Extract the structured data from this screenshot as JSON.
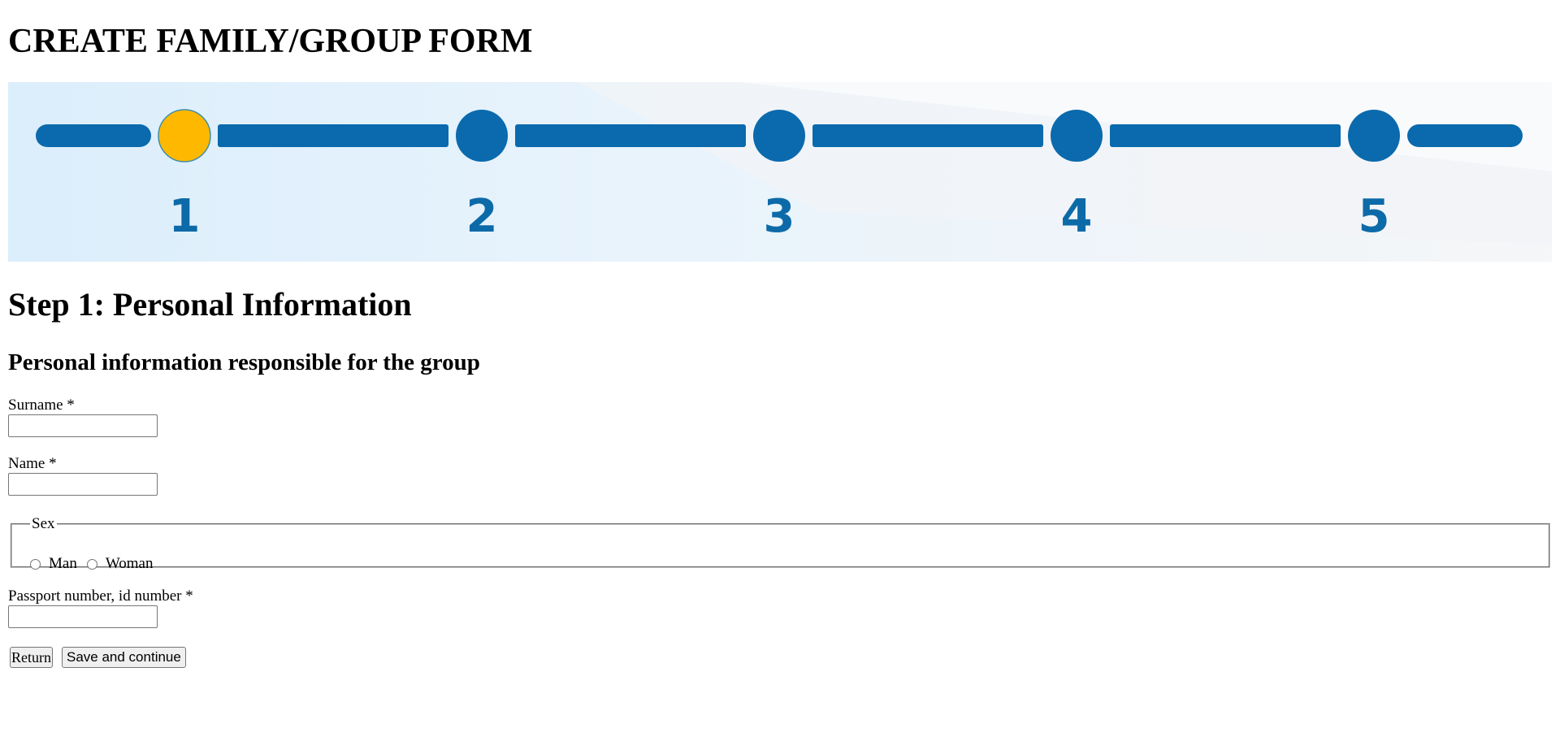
{
  "page": {
    "title": "CREATE FAMILY/GROUP FORM"
  },
  "stepper": {
    "steps": [
      "1",
      "2",
      "3",
      "4",
      "5"
    ],
    "current_step": 1,
    "colors": {
      "track": "#0a6aad",
      "active": "#ffb800",
      "inactive": "#0a6aad",
      "number": "#0d6aa8"
    }
  },
  "form": {
    "step_title": "Step 1: Personal Information",
    "section_title": "Personal information responsible for the group",
    "fields": {
      "surname": {
        "label": "Surname *",
        "value": ""
      },
      "name": {
        "label": "Name *",
        "value": ""
      },
      "sex": {
        "legend": "Sex",
        "options": [
          "Man",
          "Woman"
        ],
        "selected": null
      },
      "passport": {
        "label": "Passport number, id number *",
        "value": ""
      }
    },
    "buttons": {
      "return": "Return",
      "save": "Save and continue"
    }
  }
}
